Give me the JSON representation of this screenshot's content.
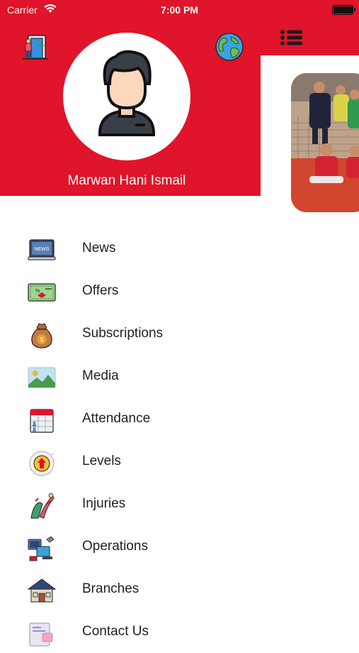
{
  "status_bar": {
    "carrier": "Carrier",
    "time": "7:00 PM",
    "battery_level": 1.0
  },
  "profile": {
    "name": "Marwan Hani Ismail"
  },
  "menu": [
    {
      "label": "News",
      "icon": "newspaper-laptop-icon"
    },
    {
      "label": "Offers",
      "icon": "voucher-icon"
    },
    {
      "label": "Subscriptions",
      "icon": "money-bag-icon"
    },
    {
      "label": "Media",
      "icon": "image-icon"
    },
    {
      "label": "Attendance",
      "icon": "calendar-icon"
    },
    {
      "label": "Levels",
      "icon": "level-up-icon"
    },
    {
      "label": "Injuries",
      "icon": "injury-icon"
    },
    {
      "label": "Operations",
      "icon": "operations-icon"
    },
    {
      "label": "Branches",
      "icon": "house-icon"
    },
    {
      "label": "Contact Us",
      "icon": "contact-icon"
    }
  ],
  "colors": {
    "primary": "#e0142a",
    "label": "#222222"
  }
}
